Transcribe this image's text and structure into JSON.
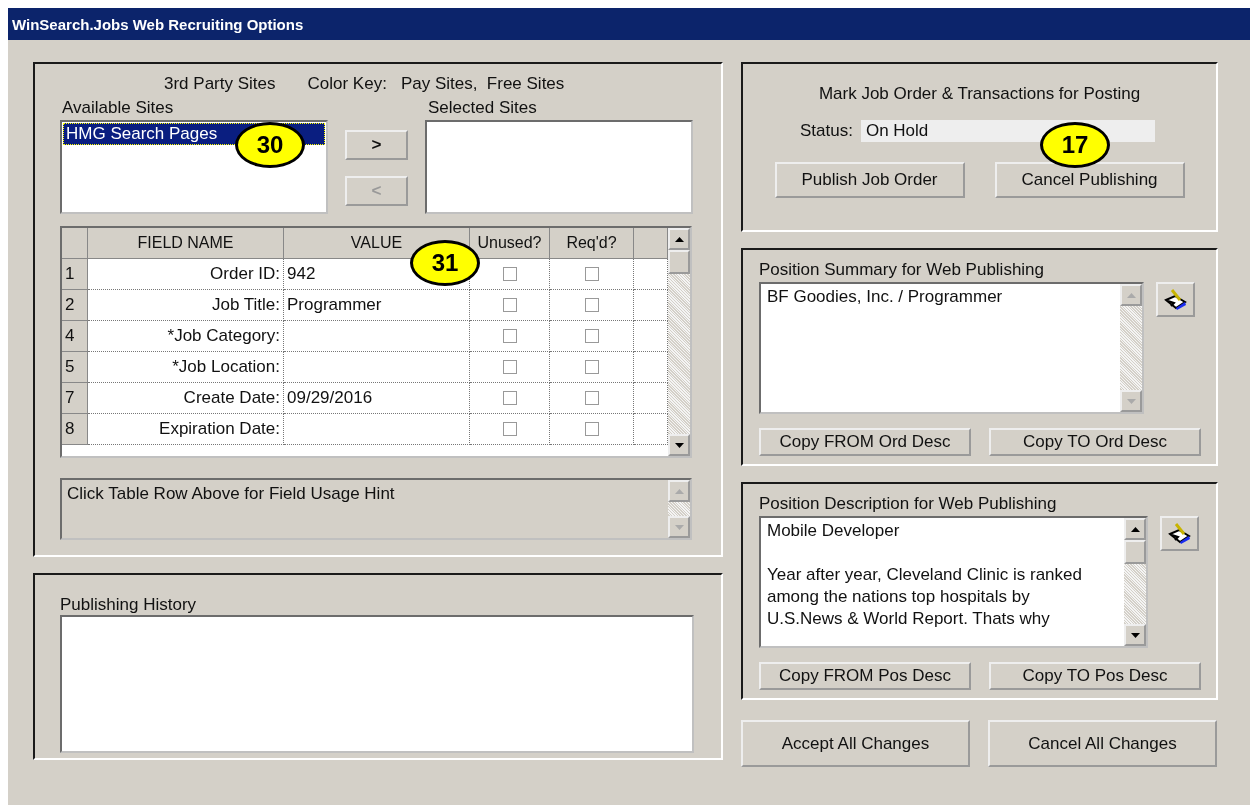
{
  "window": {
    "title": "WinSearch.Jobs Web Recruiting Options"
  },
  "sites": {
    "heading": "3rd Party Sites",
    "color_key_label": "Color Key:",
    "color_key": "Pay Sites,  Free Sites",
    "available_label": "Available Sites",
    "selected_label": "Selected Sites",
    "available": [
      {
        "label": "HMG Search Pages",
        "selected": true
      }
    ],
    "add_button": {
      "label": ">",
      "disabled": false
    },
    "remove_button": {
      "label": "<",
      "disabled": true
    }
  },
  "table": {
    "columns": [
      "FIELD NAME",
      "VALUE",
      "Unused?",
      "Req'd?"
    ],
    "rows": [
      {
        "number": "1",
        "field": "Order ID:",
        "value": "942",
        "unused": false,
        "required": false
      },
      {
        "number": "2",
        "field": "Job Title:",
        "value": "Programmer",
        "unused": false,
        "required": false
      },
      {
        "number": "4",
        "field": "*Job Category:",
        "unused": false,
        "required": false
      },
      {
        "number": "5",
        "field": "*Job Location:",
        "unused": false,
        "required": false
      },
      {
        "number": "7",
        "field": "Create Date:",
        "value": "09/29/2016",
        "unused": false,
        "required": false
      },
      {
        "number": "8",
        "field": "Expiration Date:",
        "unused": false,
        "required": false
      }
    ]
  },
  "hint": "Click Table Row Above for Field Usage Hint",
  "history": {
    "label": "Publishing History"
  },
  "posting": {
    "heading": "Mark Job Order & Transactions for Posting",
    "status_label": "Status:",
    "status": "On Hold",
    "buttons": [
      "Publish Job Order",
      "Cancel Publishing"
    ]
  },
  "summary": {
    "label": "Position Summary for Web Publishing",
    "value": "BF Goodies, Inc. / Programmer",
    "buttons": [
      "Copy FROM Ord Desc",
      "Copy TO Ord Desc"
    ]
  },
  "description": {
    "label": "Position Description for Web Publishing",
    "value": "Mobile Developer\n\nYear after year, Cleveland Clinic is ranked\namong the nations top hospitals by\nU.S.News & World Report. Thats why",
    "buttons": [
      "Copy FROM Pos Desc",
      "Copy TO Pos Desc"
    ]
  },
  "footer_buttons": [
    "Accept All Changes",
    "Cancel All Changes"
  ],
  "callouts": [
    "30",
    "31",
    "17"
  ]
}
